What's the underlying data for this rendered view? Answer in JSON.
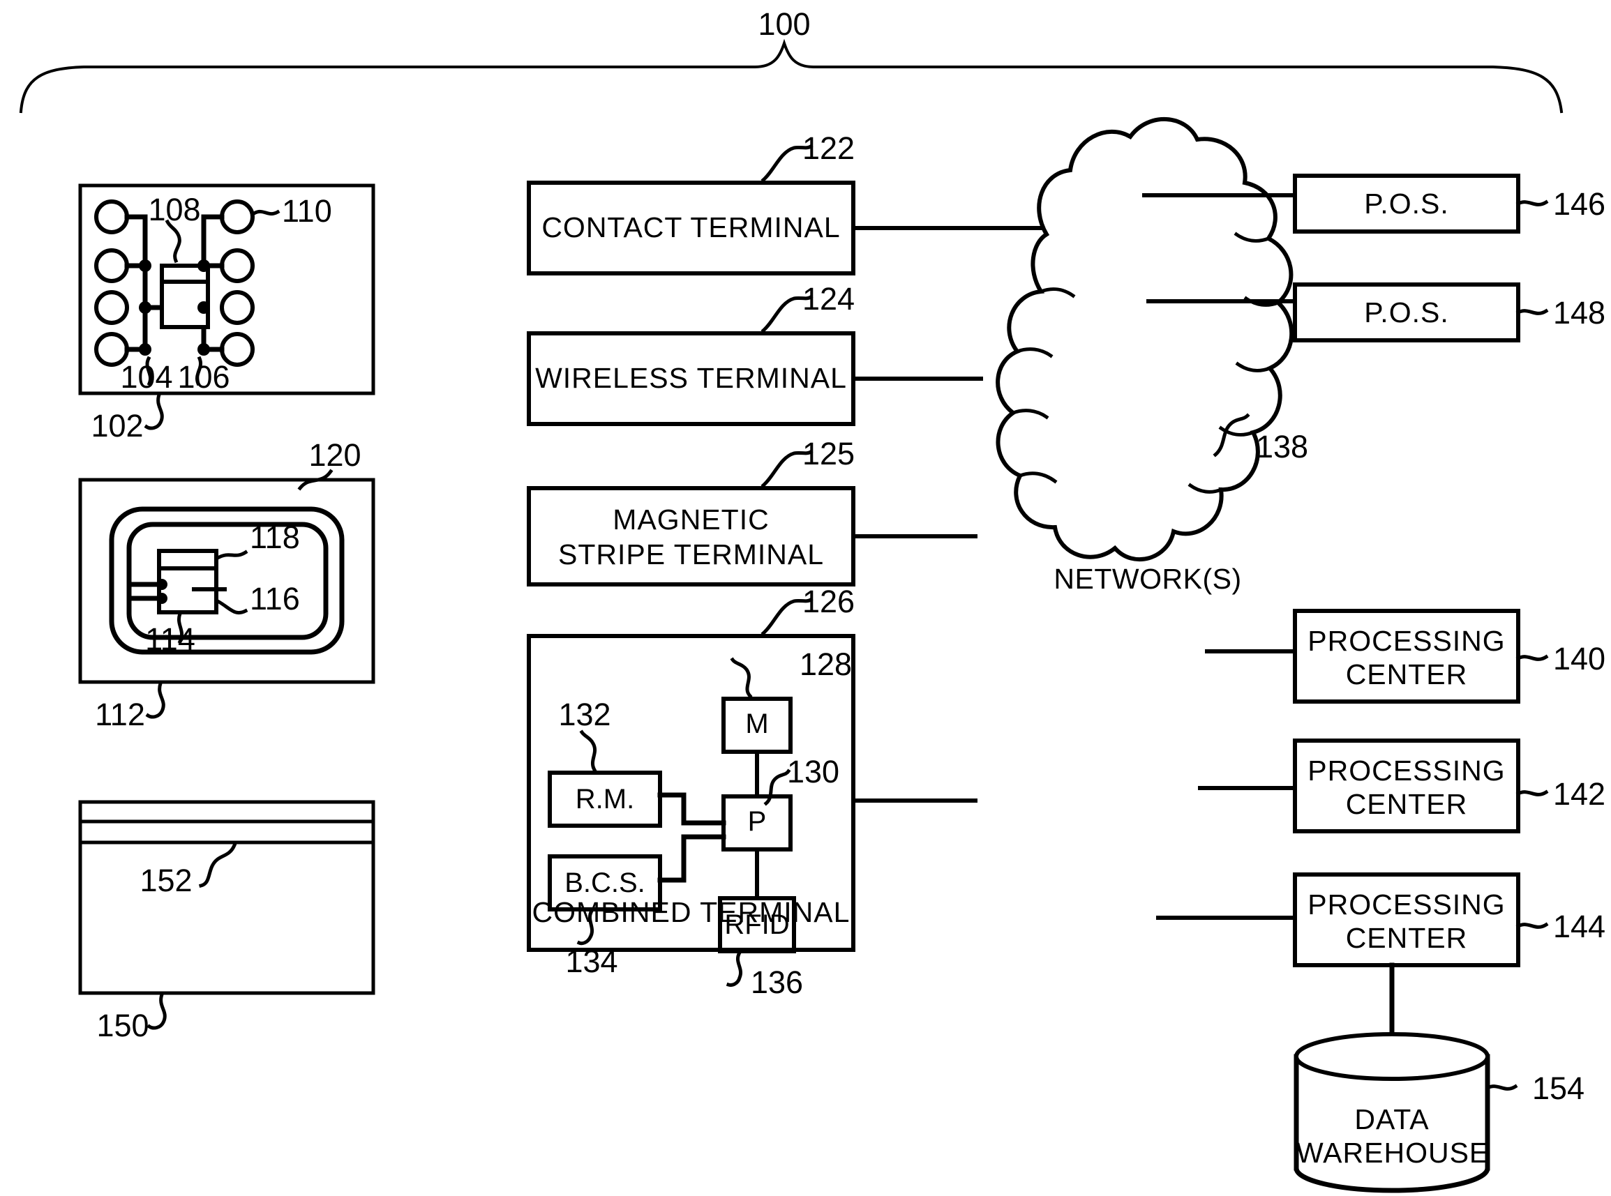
{
  "figure": {
    "system_ref": "100",
    "title_label": "100"
  },
  "chip_module": {
    "ref_module": "102",
    "ref_contacts_left": "104",
    "ref_contacts_right": "106",
    "ref_chip": "108",
    "ref_pad": "110"
  },
  "contactless_card": {
    "ref_card": "112",
    "ref_chip": "114",
    "ref_antenna_inner": "116",
    "ref_coupler": "118",
    "ref_outline": "120"
  },
  "magstripe_card": {
    "ref_card": "150",
    "ref_stripe": "152"
  },
  "terminals": [
    {
      "label": "CONTACT  TERMINAL",
      "ref": "122"
    },
    {
      "label": "WIRELESS  TERMINAL",
      "ref": "124"
    },
    {
      "label_line1": "MAGNETIC",
      "label_line2": "STRIPE  TERMINAL",
      "ref": "125"
    }
  ],
  "combined_terminal": {
    "label": "COMBINED  TERMINAL",
    "ref": "126",
    "components": [
      {
        "label": "M",
        "ref": "128"
      },
      {
        "label": "P",
        "ref": "130"
      },
      {
        "label": "R.M.",
        "ref": "132"
      },
      {
        "label": "B.C.S.",
        "ref": "134"
      },
      {
        "label": "RFID",
        "ref": "136"
      }
    ]
  },
  "network": {
    "label": "NETWORK(S)",
    "ref": "138"
  },
  "pos_nodes": [
    {
      "label": "P.O.S.",
      "ref": "146"
    },
    {
      "label": "P.O.S.",
      "ref": "148"
    }
  ],
  "processing_centers": [
    {
      "line1": "PROCESSING",
      "line2": "CENTER",
      "ref": "140"
    },
    {
      "line1": "PROCESSING",
      "line2": "CENTER",
      "ref": "142"
    },
    {
      "line1": "PROCESSING",
      "line2": "CENTER",
      "ref": "144"
    }
  ],
  "data_warehouse": {
    "line1": "DATA",
    "line2": "WAREHOUSE",
    "ref": "154"
  },
  "colors": {
    "ink": "#000000",
    "paper": "#ffffff"
  }
}
